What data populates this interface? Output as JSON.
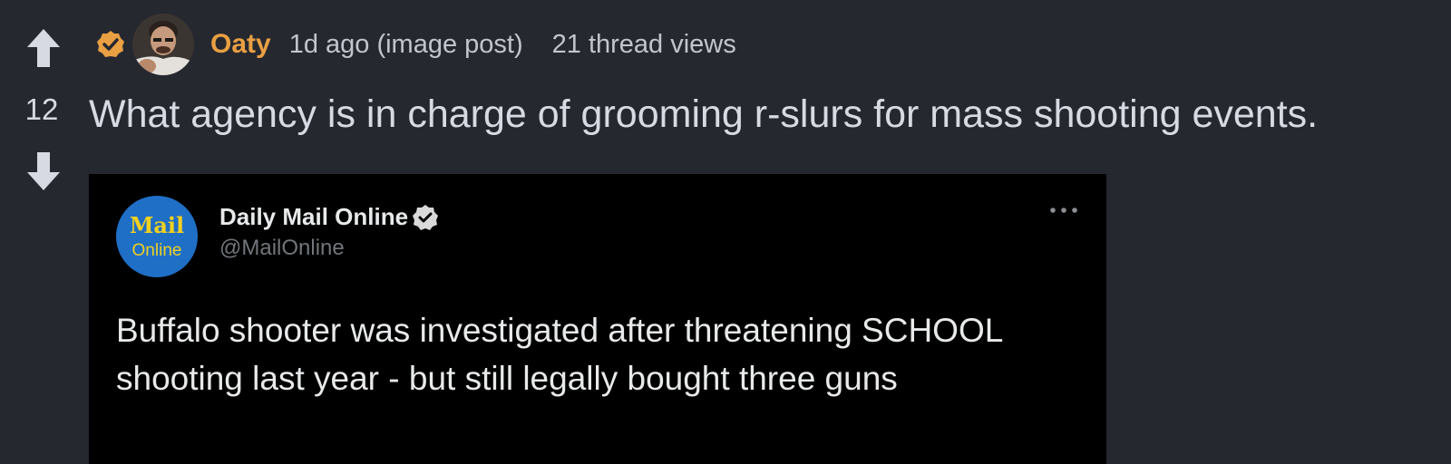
{
  "post": {
    "score": "12",
    "author": "Oaty",
    "time": "1d ago (image post)",
    "views": "21 thread views",
    "title": "What agency is in charge of grooming r-slurs for mass shooting events."
  },
  "tweet": {
    "display_name": "Daily Mail Online",
    "handle": "@MailOnline",
    "text": "Buffalo shooter was investigated after threatening SCHOOL shooting last year - but still legally bought three guns",
    "logo_text_top": "Mail",
    "logo_text_bottom": "Online"
  },
  "colors": {
    "background": "#262830",
    "author": "#e8a043",
    "badge": "#e8a043",
    "text": "#d7dae2",
    "tweet_bg": "#000000",
    "logo_bg": "#1f6fc6",
    "logo_text": "#f0d020"
  },
  "icons": {
    "upvote": "arrow-up-icon",
    "downvote": "arrow-down-icon",
    "badge": "verified-badge-icon",
    "tweet_verified": "verified-check-icon",
    "more": "ellipsis-icon"
  }
}
